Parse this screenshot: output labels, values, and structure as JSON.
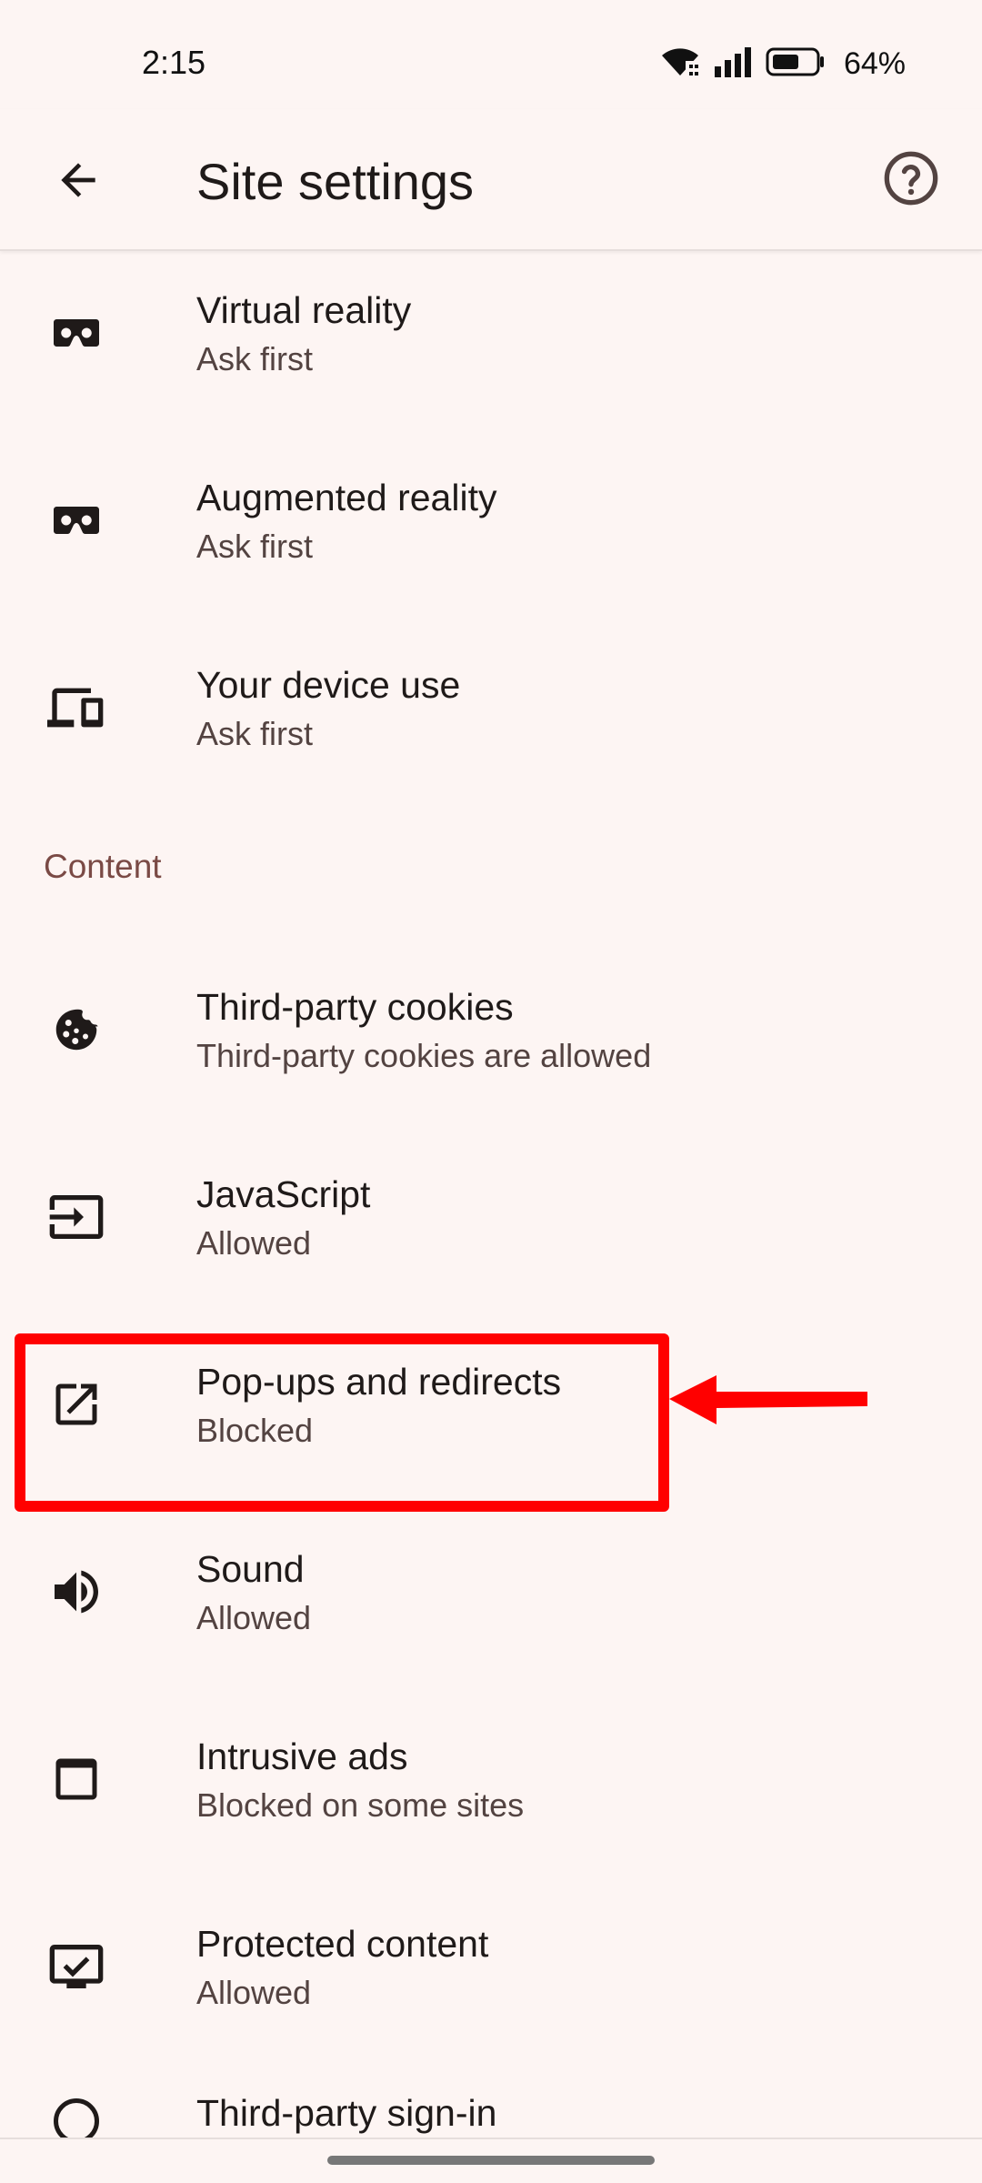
{
  "status_bar": {
    "time": "2:15",
    "battery_percent": "64%",
    "battery_level": 0.64,
    "icons": [
      "wifi-icon",
      "signal-icon",
      "battery-icon"
    ]
  },
  "app_bar": {
    "title": "Site settings",
    "back_icon": "arrow-back-icon",
    "help_icon": "help-circle-icon"
  },
  "list": {
    "items": [
      {
        "icon": "vr-headset-icon",
        "title": "Virtual reality",
        "subtitle": "Ask first"
      },
      {
        "icon": "vr-headset-icon",
        "title": "Augmented reality",
        "subtitle": "Ask first"
      },
      {
        "icon": "devices-icon",
        "title": "Your device use",
        "subtitle": "Ask first"
      }
    ],
    "content_section_label": "Content",
    "content_items": [
      {
        "icon": "cookie-icon",
        "title": "Third-party cookies",
        "subtitle": "Third-party cookies are allowed"
      },
      {
        "icon": "javascript-input-icon",
        "title": "JavaScript",
        "subtitle": "Allowed"
      },
      {
        "icon": "open-in-new-icon",
        "title": "Pop-ups and redirects",
        "subtitle": "Blocked"
      },
      {
        "icon": "volume-icon",
        "title": "Sound",
        "subtitle": "Allowed"
      },
      {
        "icon": "window-icon",
        "title": "Intrusive ads",
        "subtitle": "Blocked on some sites"
      },
      {
        "icon": "protected-screen-icon",
        "title": "Protected content",
        "subtitle": "Allowed"
      },
      {
        "icon": "account-icon",
        "title": "Third-party sign-in",
        "subtitle": ""
      }
    ]
  },
  "annotation": {
    "highlight_color": "#ff0000"
  },
  "colors": {
    "background": "#fdf5f3",
    "section_header": "#7a4a45",
    "text_primary": "#1f1a19",
    "text_secondary": "#534341"
  }
}
